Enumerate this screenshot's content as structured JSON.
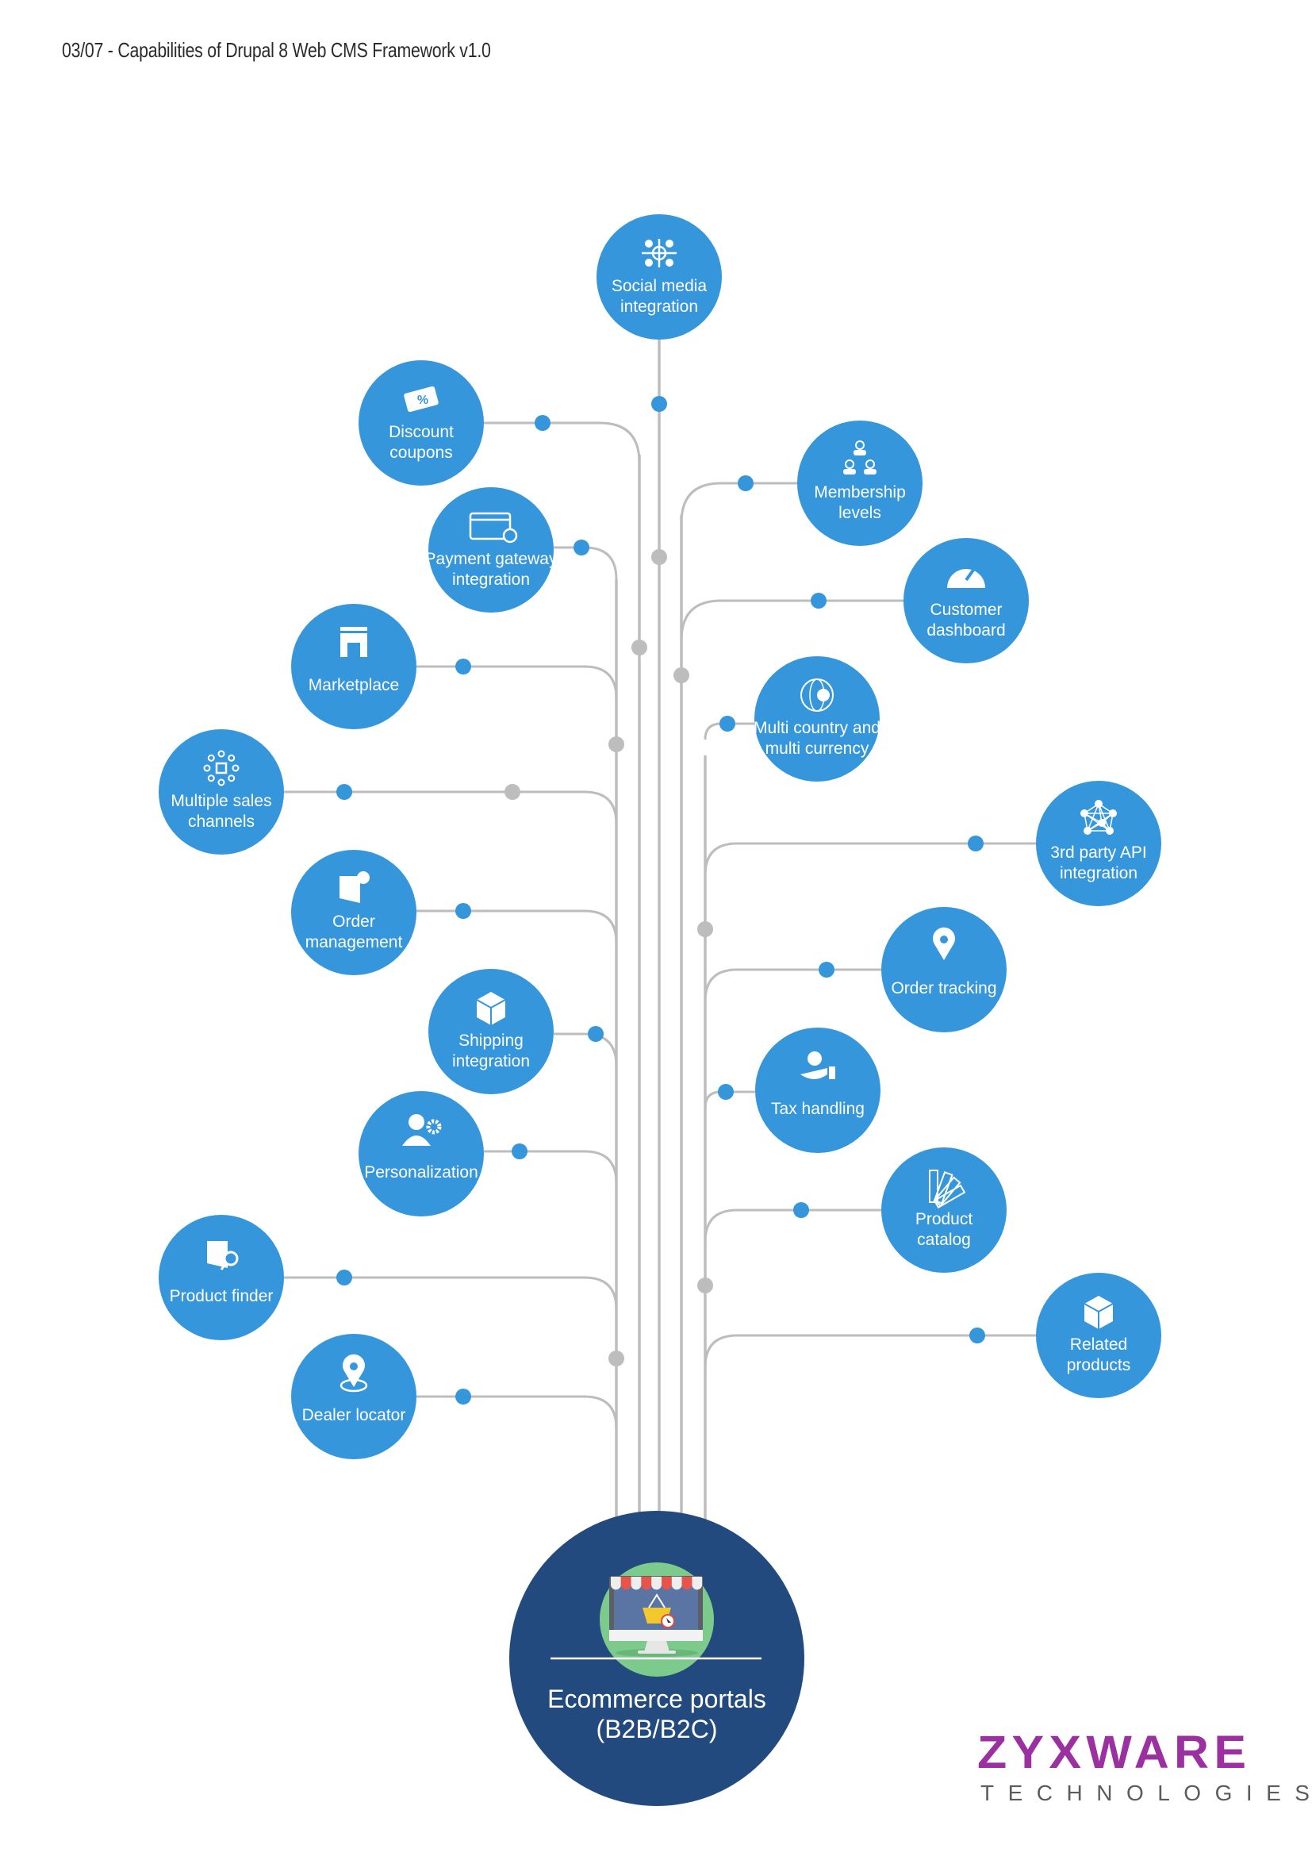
{
  "header": {
    "title": "03/07 - Capabilities of Drupal 8 Web CMS Framework v1.0"
  },
  "colors": {
    "node_fill": "#3596dc",
    "hub_fill": "#234a7e",
    "connector": "#bdbdbd",
    "joint_gray": "#bdbdbd",
    "dot_blue": "#3596dc",
    "logo_purple": "#9b30a0",
    "logo_gray": "#5c5c5c",
    "icon_green": "#7dcb8c"
  },
  "hub": {
    "lines": [
      "Ecommerce portals",
      "(B2B/B2C)"
    ],
    "icon": "ecommerce-store-monitor-icon"
  },
  "nodes": [
    {
      "id": "social-media-integration",
      "lines": [
        "Social media",
        "integration"
      ],
      "icon": "social-network-icon",
      "side": "top"
    },
    {
      "id": "discount-coupons",
      "lines": [
        "Discount",
        "coupons"
      ],
      "icon": "coupon-icon",
      "side": "left"
    },
    {
      "id": "payment-gateway-integration",
      "lines": [
        "Payment gateway",
        "integration"
      ],
      "icon": "credit-card-check-icon",
      "side": "left"
    },
    {
      "id": "marketplace",
      "lines": [
        "Marketplace"
      ],
      "icon": "storefront-icon",
      "side": "left"
    },
    {
      "id": "multiple-sales-channels",
      "lines": [
        "Multiple sales",
        "channels"
      ],
      "icon": "network-hub-icon",
      "side": "left"
    },
    {
      "id": "order-management",
      "lines": [
        "Order",
        "management"
      ],
      "icon": "package-check-icon",
      "side": "left"
    },
    {
      "id": "shipping-integration",
      "lines": [
        "Shipping",
        "integration"
      ],
      "icon": "box-icon",
      "side": "left"
    },
    {
      "id": "personalization",
      "lines": [
        "Personalization"
      ],
      "icon": "user-gear-icon",
      "side": "left"
    },
    {
      "id": "product-finder",
      "lines": [
        "Product finder"
      ],
      "icon": "package-search-icon",
      "side": "left"
    },
    {
      "id": "dealer-locator",
      "lines": [
        "Dealer locator"
      ],
      "icon": "map-pin-icon",
      "side": "left"
    },
    {
      "id": "membership-levels",
      "lines": [
        "Membership",
        "levels"
      ],
      "icon": "user-hierarchy-icon",
      "side": "right"
    },
    {
      "id": "customer-dashboard",
      "lines": [
        "Customer",
        "dashboard"
      ],
      "icon": "speedometer-icon",
      "side": "right"
    },
    {
      "id": "multi-country-currency",
      "lines": [
        "Multi country and",
        "multi currency"
      ],
      "icon": "globe-currency-icon",
      "side": "right"
    },
    {
      "id": "third-party-api-integration",
      "lines": [
        "3rd party API",
        "integration"
      ],
      "icon": "api-network-icon",
      "side": "right"
    },
    {
      "id": "order-tracking",
      "lines": [
        "Order tracking"
      ],
      "icon": "location-package-icon",
      "side": "right"
    },
    {
      "id": "tax-handling",
      "lines": [
        "Tax handling"
      ],
      "icon": "hand-coin-icon",
      "side": "right"
    },
    {
      "id": "product-catalog",
      "lines": [
        "Product",
        "catalog"
      ],
      "icon": "swatch-fan-icon",
      "side": "right"
    },
    {
      "id": "related-products",
      "lines": [
        "Related",
        "products"
      ],
      "icon": "taped-box-icon",
      "side": "right"
    }
  ],
  "logo": {
    "word": "ZYXWARE",
    "sub": "TECHNOLOGIES"
  }
}
